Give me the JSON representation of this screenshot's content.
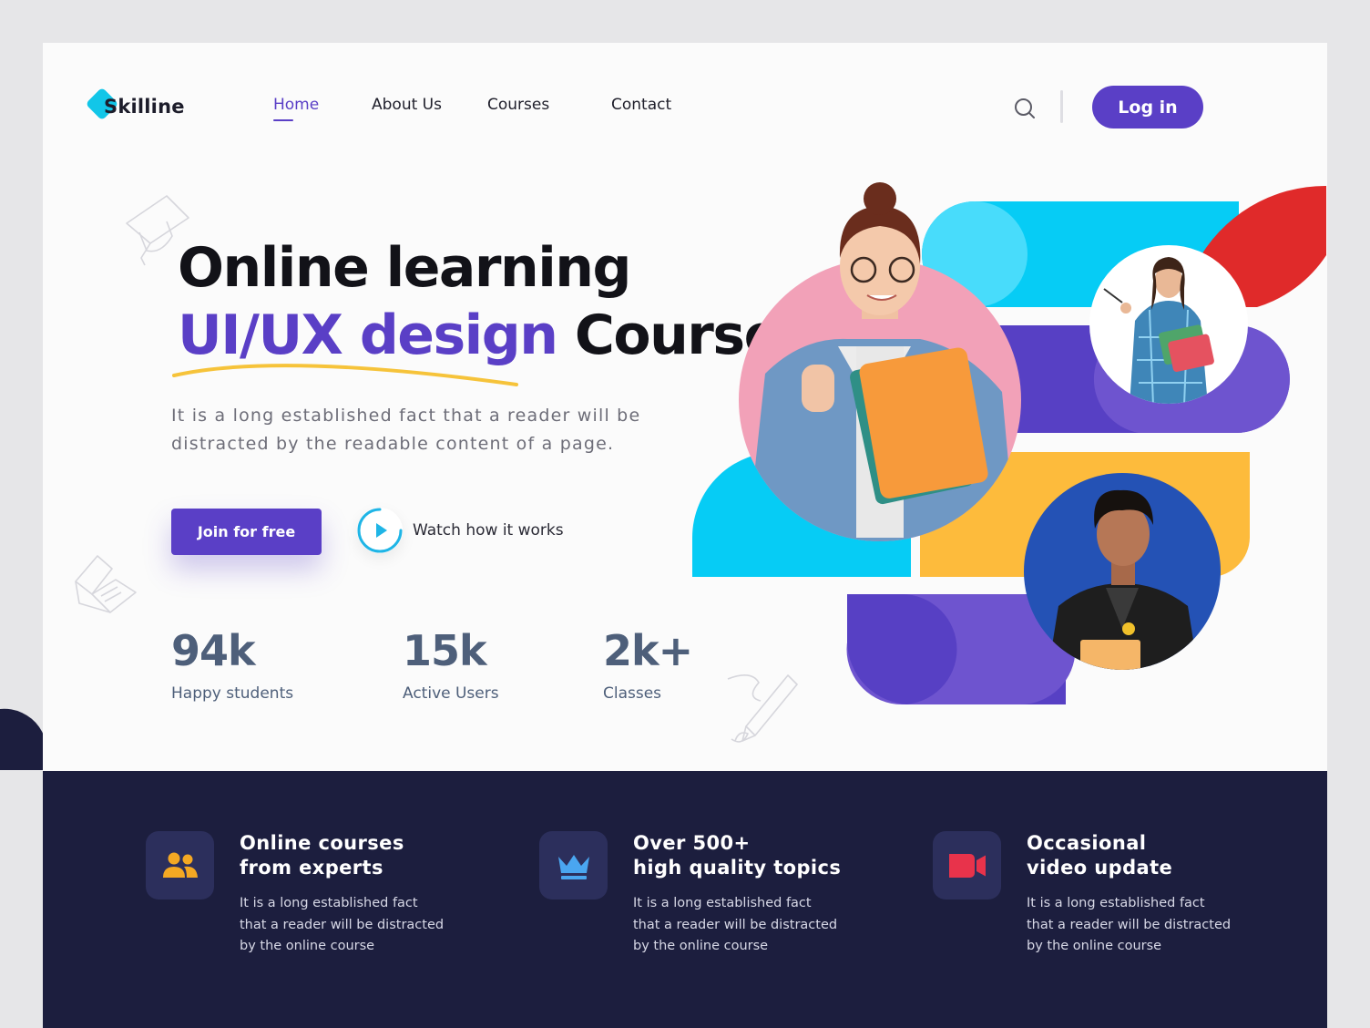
{
  "brand": {
    "name": "Skilline",
    "logo_color": "#12c6e8"
  },
  "nav": {
    "items": [
      {
        "label": "Home",
        "active": true
      },
      {
        "label": "About Us",
        "active": false
      },
      {
        "label": "Courses",
        "active": false
      },
      {
        "label": "Contact",
        "active": false
      }
    ],
    "search_icon": "search-icon",
    "login_label": "Log in"
  },
  "hero": {
    "title_line1": "Online learning",
    "title_accent": "UI/UX design",
    "title_rest": "Course",
    "description": "It is a long established fact that a reader will be distracted by the readable content of a page.",
    "cta_label": "Join for free",
    "watch_label": "Watch how it works"
  },
  "stats": [
    {
      "value": "94k",
      "label": "Happy students"
    },
    {
      "value": "15k",
      "label": "Active Users"
    },
    {
      "value": "2k+",
      "label": "Classes"
    }
  ],
  "features": [
    {
      "icon": "users-icon",
      "title": "Online courses\nfrom experts",
      "description": "It is a long established fact\nthat a reader will be distracted\nby the online course",
      "icon_color": "#f4a823"
    },
    {
      "icon": "crown-icon",
      "title": "Over 500+\nhigh quality topics",
      "description": "It is a long established fact\nthat a reader will be distracted\nby the online course",
      "icon_color": "#4aa6f0"
    },
    {
      "icon": "video-camera-icon",
      "title": "Occasional\nvideo update",
      "description": "It is a long established fact\nthat a reader will be distracted\nby the online course",
      "icon_color": "#e8334b"
    }
  ],
  "colors": {
    "primary": "#5a3fc6",
    "cyan": "#06ccf5",
    "yellow": "#fdbb3c",
    "red": "#e02a2a",
    "pink": "#f2a1b8",
    "navy": "#1c1e3e",
    "stat_text": "#4e5f7a"
  },
  "photos": [
    {
      "name": "student-with-books-photo"
    },
    {
      "name": "girl-with-folders-photo"
    },
    {
      "name": "young-man-photo"
    }
  ]
}
